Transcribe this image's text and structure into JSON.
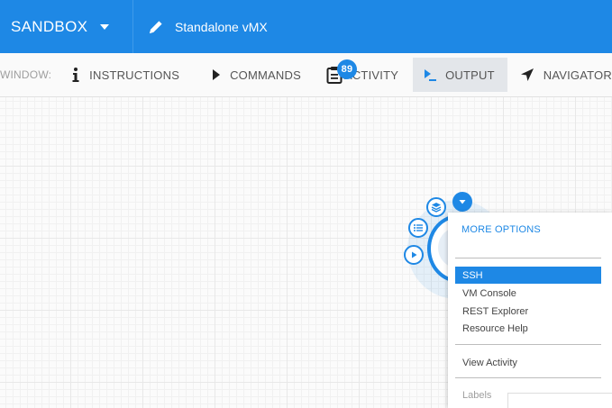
{
  "header": {
    "sandbox_label": "SANDBOX",
    "sandbox_icon": "chevron-down-icon",
    "title": "Standalone vMX",
    "title_icon": "pencil-icon"
  },
  "toolbar": {
    "window_label": "WINDOW:",
    "items": [
      {
        "label": "INSTRUCTIONS",
        "icon": "info-icon"
      },
      {
        "label": "COMMANDS",
        "icon": "play-triangle-icon"
      },
      {
        "label": "ACTIVITY",
        "icon": "clipboard-icon",
        "badge": "89"
      },
      {
        "label": "OUTPUT",
        "icon": "terminal-icon",
        "active": true
      },
      {
        "label": "NAVIGATOR",
        "icon": "navigation-arrow-icon"
      }
    ]
  },
  "node_menu": {
    "header": "MORE OPTIONS",
    "items": [
      {
        "label": "SSH",
        "selected": true
      },
      {
        "label": "VM Console"
      },
      {
        "label": "REST Explorer"
      },
      {
        "label": "Resource Help"
      }
    ],
    "secondary_items": [
      {
        "label": "View Activity"
      }
    ],
    "footer_item": {
      "label": "Labels"
    }
  },
  "colors": {
    "brand": "#1e88e5",
    "toolbar_bg": "#fafafa",
    "active_tab_bg": "#e3e6ea",
    "grid_line": "#e8e8e8"
  }
}
